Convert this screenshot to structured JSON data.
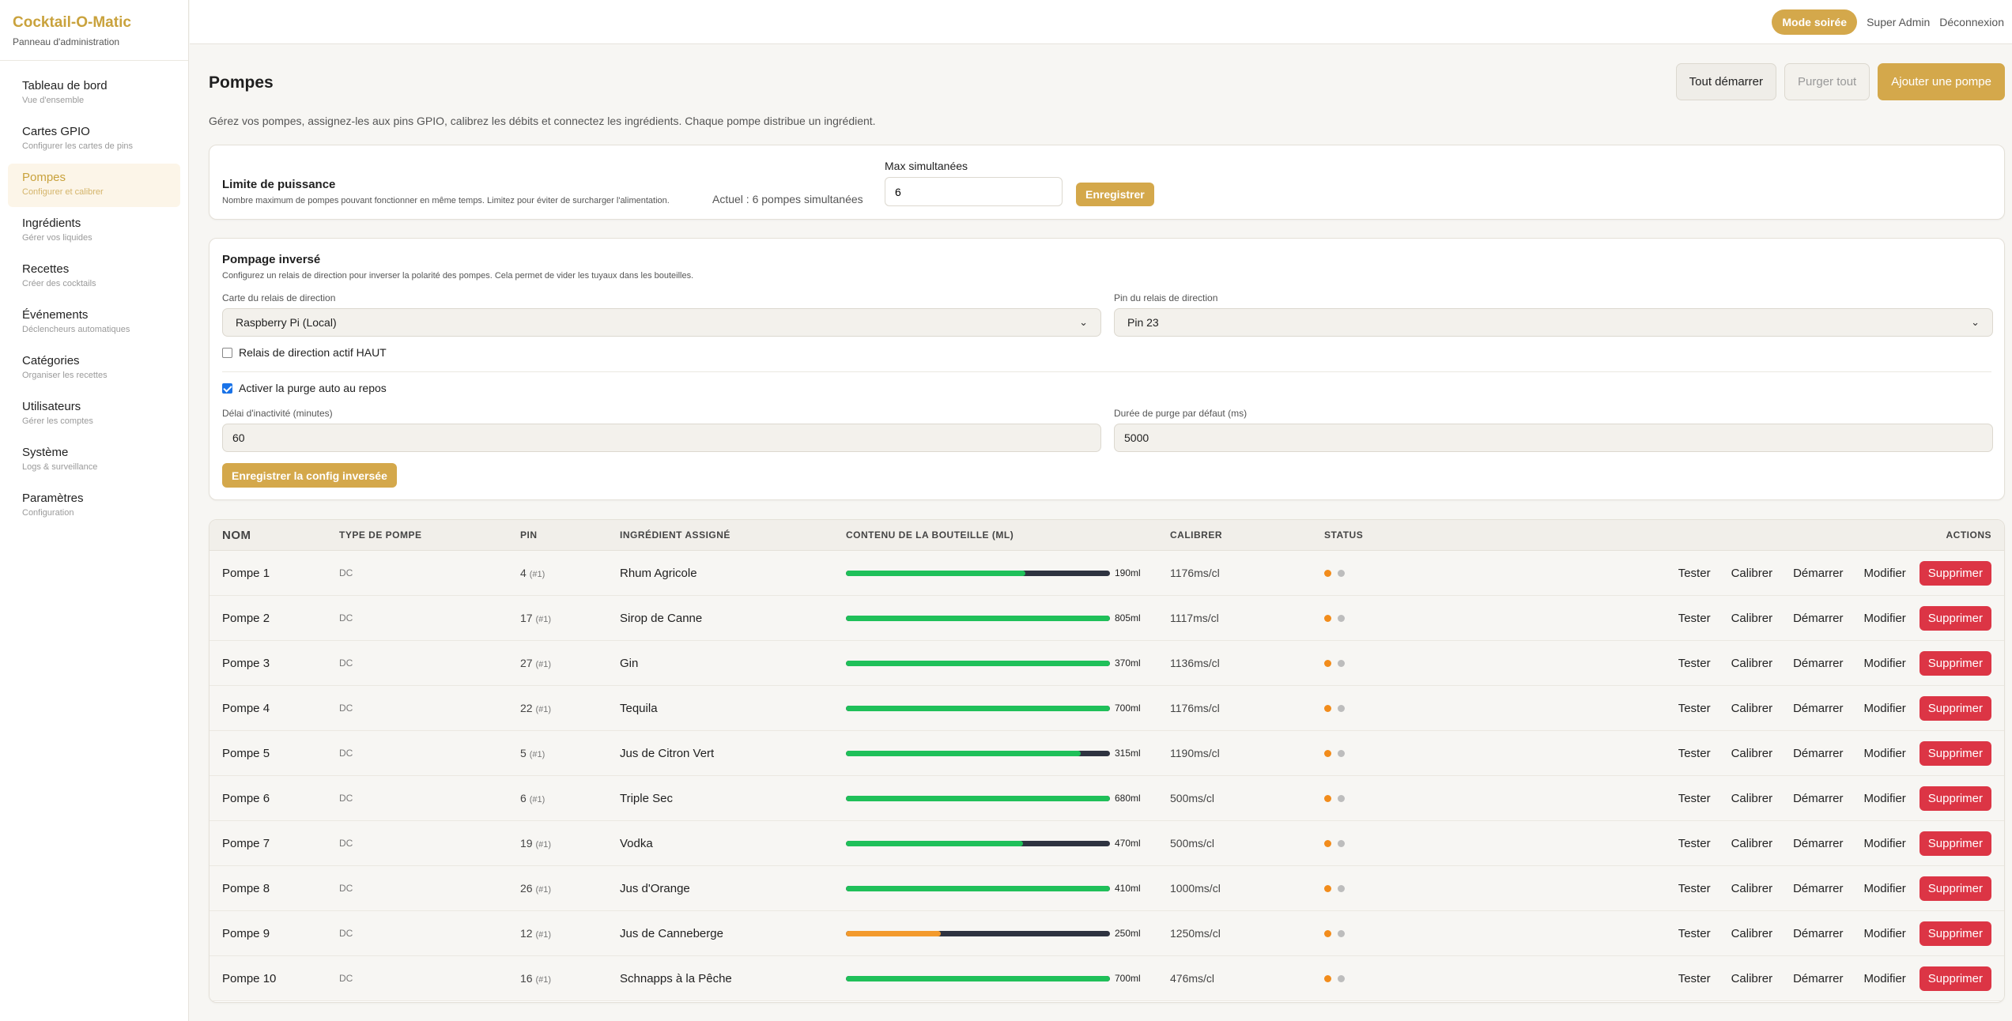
{
  "brand": {
    "title": "Cocktail-O-Matic",
    "subtitle": "Panneau d'administration"
  },
  "nav": [
    {
      "label": "Tableau de bord",
      "sub": "Vue d'ensemble"
    },
    {
      "label": "Cartes GPIO",
      "sub": "Configurer les cartes de pins"
    },
    {
      "label": "Pompes",
      "sub": "Configurer et calibrer",
      "active": true
    },
    {
      "label": "Ingrédients",
      "sub": "Gérer vos liquides"
    },
    {
      "label": "Recettes",
      "sub": "Créer des cocktails"
    },
    {
      "label": "Événements",
      "sub": "Déclencheurs automatiques"
    },
    {
      "label": "Catégories",
      "sub": "Organiser les recettes"
    },
    {
      "label": "Utilisateurs",
      "sub": "Gérer les comptes"
    },
    {
      "label": "Système",
      "sub": "Logs & surveillance"
    },
    {
      "label": "Paramètres",
      "sub": "Configuration"
    }
  ],
  "topbar": {
    "party_mode": "Mode soirée",
    "user": "Super Admin",
    "logout": "Déconnexion"
  },
  "page": {
    "title": "Pompes",
    "description": "Gérez vos pompes, assignez-les aux pins GPIO, calibrez les débits et connectez les ingrédients. Chaque pompe distribue un ingrédient.",
    "start_all": "Tout démarrer",
    "purge_all": "Purger tout",
    "add_pump": "Ajouter une pompe"
  },
  "power": {
    "title": "Limite de puissance",
    "subtitle": "Nombre maximum de pompes pouvant fonctionner en même temps. Limitez pour éviter de surcharger l'alimentation.",
    "current": "Actuel : 6 pompes simultanées",
    "max_label": "Max simultanées",
    "max_value": "6",
    "save": "Enregistrer"
  },
  "reverse": {
    "title": "Pompage inversé",
    "subtitle": "Configurez un relais de direction pour inverser la polarité des pompes. Cela permet de vider les tuyaux dans les bouteilles.",
    "board_label": "Carte du relais de direction",
    "board_value": "Raspberry Pi (Local)",
    "pin_label": "Pin du relais de direction",
    "pin_value": "Pin 23",
    "active_high_label": "Relais de direction actif HAUT",
    "auto_purge_label": "Activer la purge auto au repos",
    "idle_label": "Délai d'inactivité (minutes)",
    "idle_value": "60",
    "purge_label": "Durée de purge par défaut (ms)",
    "purge_value": "5000",
    "save": "Enregistrer la config inversée"
  },
  "table": {
    "headers": [
      "NOM",
      "TYPE DE POMPE",
      "PIN",
      "INGRÉDIENT ASSIGNÉ",
      "CONTENU DE LA BOUTEILLE (ML)",
      "CALIBRER",
      "STATUS",
      "ACTIONS"
    ],
    "action_labels": {
      "test": "Tester",
      "calibrate": "Calibrer",
      "start": "Démarrer",
      "edit": "Modifier",
      "delete": "Supprimer"
    },
    "rows": [
      {
        "name": "Pompe 1",
        "type": "DC",
        "pin": "4",
        "pin_sub": "(#1)",
        "ingredient": "Rhum Agricole",
        "fill": 0.68,
        "bar_color": "green",
        "ml": "190ml",
        "cal": "1176ms/cl"
      },
      {
        "name": "Pompe 2",
        "type": "DC",
        "pin": "17",
        "pin_sub": "(#1)",
        "ingredient": "Sirop de Canne",
        "fill": 1.0,
        "bar_color": "green",
        "ml": "805ml",
        "cal": "1117ms/cl"
      },
      {
        "name": "Pompe 3",
        "type": "DC",
        "pin": "27",
        "pin_sub": "(#1)",
        "ingredient": "Gin",
        "fill": 1.0,
        "bar_color": "green",
        "ml": "370ml",
        "cal": "1136ms/cl"
      },
      {
        "name": "Pompe 4",
        "type": "DC",
        "pin": "22",
        "pin_sub": "(#1)",
        "ingredient": "Tequila",
        "fill": 1.0,
        "bar_color": "green",
        "ml": "700ml",
        "cal": "1176ms/cl"
      },
      {
        "name": "Pompe 5",
        "type": "DC",
        "pin": "5",
        "pin_sub": "(#1)",
        "ingredient": "Jus de Citron Vert",
        "fill": 0.89,
        "bar_color": "green",
        "ml": "315ml",
        "cal": "1190ms/cl"
      },
      {
        "name": "Pompe 6",
        "type": "DC",
        "pin": "6",
        "pin_sub": "(#1)",
        "ingredient": "Triple Sec",
        "fill": 1.0,
        "bar_color": "green",
        "ml": "680ml",
        "cal": "500ms/cl"
      },
      {
        "name": "Pompe 7",
        "type": "DC",
        "pin": "19",
        "pin_sub": "(#1)",
        "ingredient": "Vodka",
        "fill": 0.67,
        "bar_color": "green",
        "ml": "470ml",
        "cal": "500ms/cl"
      },
      {
        "name": "Pompe 8",
        "type": "DC",
        "pin": "26",
        "pin_sub": "(#1)",
        "ingredient": "Jus d'Orange",
        "fill": 1.0,
        "bar_color": "green",
        "ml": "410ml",
        "cal": "1000ms/cl"
      },
      {
        "name": "Pompe 9",
        "type": "DC",
        "pin": "12",
        "pin_sub": "(#1)",
        "ingredient": "Jus de Canneberge",
        "fill": 0.36,
        "bar_color": "orange",
        "ml": "250ml",
        "cal": "1250ms/cl"
      },
      {
        "name": "Pompe 10",
        "type": "DC",
        "pin": "16",
        "pin_sub": "(#1)",
        "ingredient": "Schnapps à la Pêche",
        "fill": 1.0,
        "bar_color": "green",
        "ml": "700ml",
        "cal": "476ms/cl"
      }
    ]
  },
  "colors": {
    "status_active": "#f28c1b",
    "status_idle": "#bdbdbd",
    "accent": "#d4a84b"
  }
}
